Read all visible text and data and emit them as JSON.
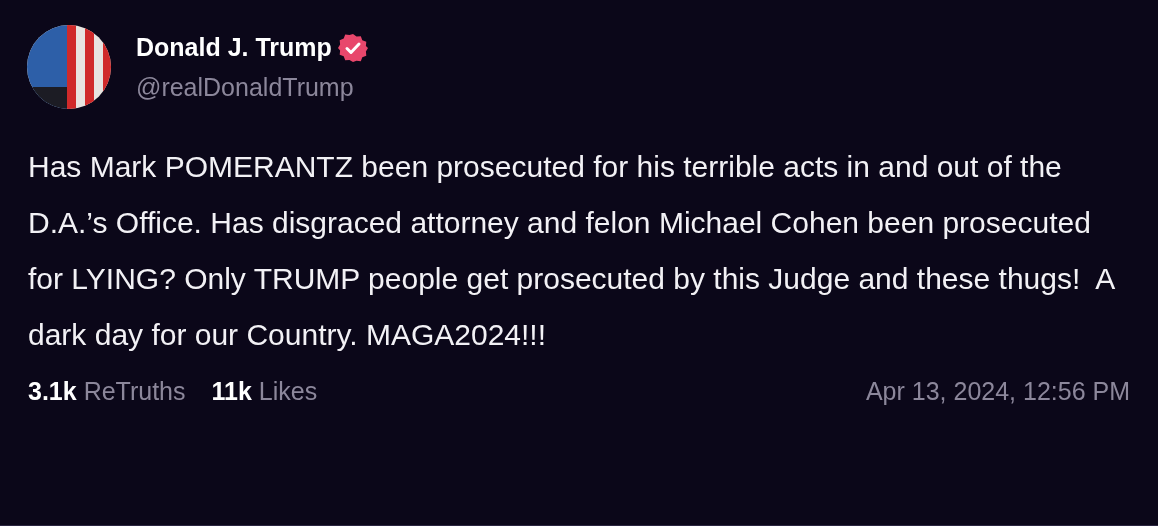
{
  "post": {
    "author": {
      "name": "Donald J. Trump",
      "verified": true,
      "handle": "@realDonaldTrump"
    },
    "text": "Has Mark POMERANTZ been prosecuted for his terrible acts in and out of the D.A.’s Office. Has disgraced attorney and felon Michael Cohen been prosecuted for LYING? Only TRUMP people get prosecuted by this Judge and these thugs!  A dark day for our Country. MAGA2024!!!",
    "stats": [
      {
        "count": "3.1k",
        "label": "ReTruths"
      },
      {
        "count": "11k",
        "label": "Likes"
      }
    ],
    "timestamp": "Apr 13, 2024, 12:56 PM"
  }
}
